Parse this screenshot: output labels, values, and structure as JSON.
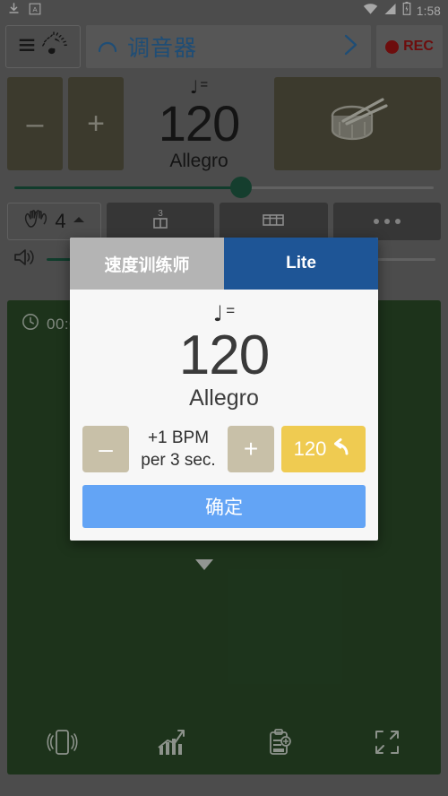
{
  "status_bar": {
    "time": "1:58",
    "icons": [
      "download-icon",
      "a-badge-icon",
      "wifi-icon",
      "signal-icon",
      "battery-icon"
    ]
  },
  "toolbar": {
    "menu_icon": "hamburger-menu-icon",
    "app_icon": "metronome-note-icon",
    "tuner_label": "调音器",
    "tuner_leading_icon": "arc-icon",
    "chevron_icon": "chevron-right-icon",
    "rec_label": "REC"
  },
  "tempo": {
    "minus_label": "–",
    "plus_label": "+",
    "note_symbol": "♩",
    "equals": "=",
    "bpm": "120",
    "marking": "Allegro",
    "drum_icon": "snare-drum-icon",
    "slider_percent": 54
  },
  "controls": {
    "beat_icon": "clapping-hands-icon",
    "beat_count": "4",
    "beat_chevron": "chevron-up-icon",
    "subdivision_icon": "triplet-note-icon",
    "subdivision_label": "3",
    "bars_icon": "measure-grid-icon",
    "more_icon": "overflow-dots-icon"
  },
  "volume": {
    "icon": "speaker-waves-icon",
    "percent": 36
  },
  "practice_panel": {
    "timer_icon": "clock-icon",
    "timer_text": "00:00",
    "nav": [
      {
        "icon": "vibrate-phone-icon",
        "name": "vibration"
      },
      {
        "icon": "bar-chart-trend-icon",
        "name": "statistics"
      },
      {
        "icon": "clipboard-add-icon",
        "name": "setlist"
      },
      {
        "icon": "fullscreen-expand-icon",
        "name": "fullscreen"
      }
    ]
  },
  "dialog": {
    "tab_inactive": "速度训练师",
    "tab_active": "Lite",
    "note_symbol": "♩",
    "equals": "=",
    "bpm": "120",
    "marking": "Allegro",
    "minus_label": "–",
    "plus_label": "+",
    "rate_line1": "+1 BPM",
    "rate_line2": "per  3 sec.",
    "reset_value": "120",
    "reset_icon": "undo-arrow-icon",
    "confirm_label": "确定"
  },
  "colors": {
    "background": "#6e6e6e",
    "pad": "#565441",
    "green_panel": "#2a4a28",
    "accent_blue": "#1e5596",
    "confirm_blue": "#63a4f5",
    "reset_yellow": "#efcb51",
    "rec_red": "#9c1414",
    "slider_green": "#19573f",
    "tuner_blue": "#2d6fa8"
  }
}
